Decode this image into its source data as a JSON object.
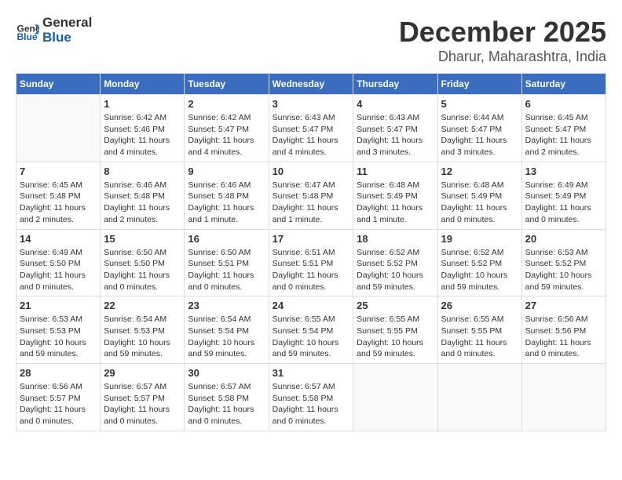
{
  "header": {
    "logo_general": "General",
    "logo_blue": "Blue",
    "month_title": "December 2025",
    "location": "Dharur, Maharashtra, India"
  },
  "calendar": {
    "days_of_week": [
      "Sunday",
      "Monday",
      "Tuesday",
      "Wednesday",
      "Thursday",
      "Friday",
      "Saturday"
    ],
    "weeks": [
      [
        {
          "day": "",
          "info": ""
        },
        {
          "day": "1",
          "info": "Sunrise: 6:42 AM\nSunset: 5:46 PM\nDaylight: 11 hours\nand 4 minutes."
        },
        {
          "day": "2",
          "info": "Sunrise: 6:42 AM\nSunset: 5:47 PM\nDaylight: 11 hours\nand 4 minutes."
        },
        {
          "day": "3",
          "info": "Sunrise: 6:43 AM\nSunset: 5:47 PM\nDaylight: 11 hours\nand 4 minutes."
        },
        {
          "day": "4",
          "info": "Sunrise: 6:43 AM\nSunset: 5:47 PM\nDaylight: 11 hours\nand 3 minutes."
        },
        {
          "day": "5",
          "info": "Sunrise: 6:44 AM\nSunset: 5:47 PM\nDaylight: 11 hours\nand 3 minutes."
        },
        {
          "day": "6",
          "info": "Sunrise: 6:45 AM\nSunset: 5:47 PM\nDaylight: 11 hours\nand 2 minutes."
        }
      ],
      [
        {
          "day": "7",
          "info": "Sunrise: 6:45 AM\nSunset: 5:48 PM\nDaylight: 11 hours\nand 2 minutes."
        },
        {
          "day": "8",
          "info": "Sunrise: 6:46 AM\nSunset: 5:48 PM\nDaylight: 11 hours\nand 2 minutes."
        },
        {
          "day": "9",
          "info": "Sunrise: 6:46 AM\nSunset: 5:48 PM\nDaylight: 11 hours\nand 1 minute."
        },
        {
          "day": "10",
          "info": "Sunrise: 6:47 AM\nSunset: 5:48 PM\nDaylight: 11 hours\nand 1 minute."
        },
        {
          "day": "11",
          "info": "Sunrise: 6:48 AM\nSunset: 5:49 PM\nDaylight: 11 hours\nand 1 minute."
        },
        {
          "day": "12",
          "info": "Sunrise: 6:48 AM\nSunset: 5:49 PM\nDaylight: 11 hours\nand 0 minutes."
        },
        {
          "day": "13",
          "info": "Sunrise: 6:49 AM\nSunset: 5:49 PM\nDaylight: 11 hours\nand 0 minutes."
        }
      ],
      [
        {
          "day": "14",
          "info": "Sunrise: 6:49 AM\nSunset: 5:50 PM\nDaylight: 11 hours\nand 0 minutes."
        },
        {
          "day": "15",
          "info": "Sunrise: 6:50 AM\nSunset: 5:50 PM\nDaylight: 11 hours\nand 0 minutes."
        },
        {
          "day": "16",
          "info": "Sunrise: 6:50 AM\nSunset: 5:51 PM\nDaylight: 11 hours\nand 0 minutes."
        },
        {
          "day": "17",
          "info": "Sunrise: 6:51 AM\nSunset: 5:51 PM\nDaylight: 11 hours\nand 0 minutes."
        },
        {
          "day": "18",
          "info": "Sunrise: 6:52 AM\nSunset: 5:52 PM\nDaylight: 10 hours\nand 59 minutes."
        },
        {
          "day": "19",
          "info": "Sunrise: 6:52 AM\nSunset: 5:52 PM\nDaylight: 10 hours\nand 59 minutes."
        },
        {
          "day": "20",
          "info": "Sunrise: 6:53 AM\nSunset: 5:52 PM\nDaylight: 10 hours\nand 59 minutes."
        }
      ],
      [
        {
          "day": "21",
          "info": "Sunrise: 6:53 AM\nSunset: 5:53 PM\nDaylight: 10 hours\nand 59 minutes."
        },
        {
          "day": "22",
          "info": "Sunrise: 6:54 AM\nSunset: 5:53 PM\nDaylight: 10 hours\nand 59 minutes."
        },
        {
          "day": "23",
          "info": "Sunrise: 6:54 AM\nSunset: 5:54 PM\nDaylight: 10 hours\nand 59 minutes."
        },
        {
          "day": "24",
          "info": "Sunrise: 6:55 AM\nSunset: 5:54 PM\nDaylight: 10 hours\nand 59 minutes."
        },
        {
          "day": "25",
          "info": "Sunrise: 6:55 AM\nSunset: 5:55 PM\nDaylight: 10 hours\nand 59 minutes."
        },
        {
          "day": "26",
          "info": "Sunrise: 6:55 AM\nSunset: 5:55 PM\nDaylight: 11 hours\nand 0 minutes."
        },
        {
          "day": "27",
          "info": "Sunrise: 6:56 AM\nSunset: 5:56 PM\nDaylight: 11 hours\nand 0 minutes."
        }
      ],
      [
        {
          "day": "28",
          "info": "Sunrise: 6:56 AM\nSunset: 5:57 PM\nDaylight: 11 hours\nand 0 minutes."
        },
        {
          "day": "29",
          "info": "Sunrise: 6:57 AM\nSunset: 5:57 PM\nDaylight: 11 hours\nand 0 minutes."
        },
        {
          "day": "30",
          "info": "Sunrise: 6:57 AM\nSunset: 5:58 PM\nDaylight: 11 hours\nand 0 minutes."
        },
        {
          "day": "31",
          "info": "Sunrise: 6:57 AM\nSunset: 5:58 PM\nDaylight: 11 hours\nand 0 minutes."
        },
        {
          "day": "",
          "info": ""
        },
        {
          "day": "",
          "info": ""
        },
        {
          "day": "",
          "info": ""
        }
      ]
    ]
  }
}
